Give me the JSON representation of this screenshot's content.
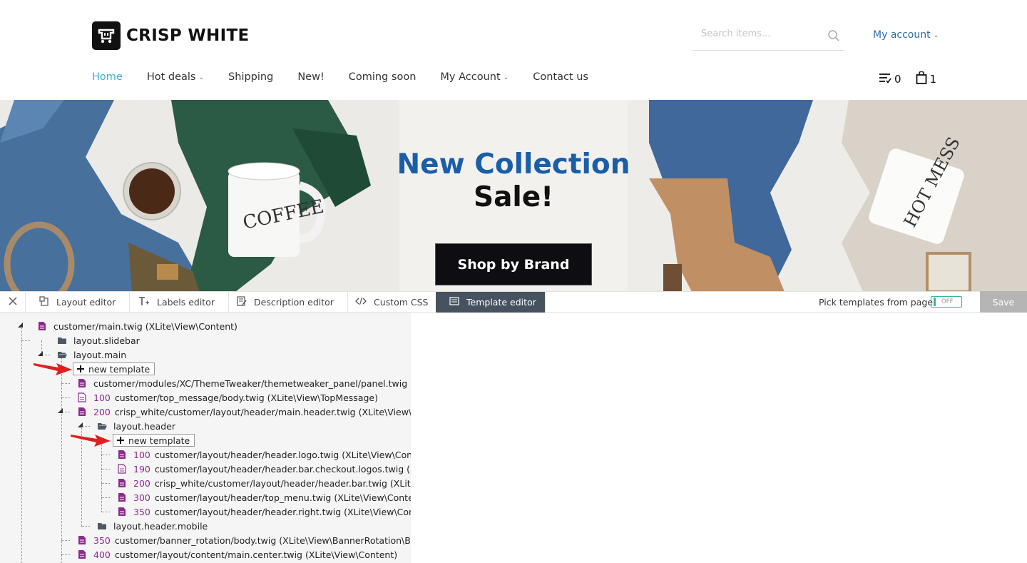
{
  "header": {
    "logo_text": "CRISP WHITE",
    "search_placeholder": "Search items...",
    "my_account": "My account"
  },
  "nav": [
    {
      "label": "Home",
      "active": true,
      "caret": false
    },
    {
      "label": "Hot deals",
      "caret": true
    },
    {
      "label": "Shipping",
      "caret": false
    },
    {
      "label": "New!",
      "caret": false
    },
    {
      "label": "Coming soon",
      "caret": false
    },
    {
      "label": "My Account",
      "caret": true
    },
    {
      "label": "Contact us",
      "caret": false
    }
  ],
  "header_icons": {
    "compare_count": "0",
    "cart_count": "1"
  },
  "banner": {
    "title": "New Collection",
    "subtitle": "Sale!",
    "button": "Shop by Brand",
    "mug_left_text": "COFFEE",
    "mug_right_text": "HOT MESS"
  },
  "tweaker": {
    "tabs": [
      {
        "label": "Layout editor",
        "icon": "layout-icon"
      },
      {
        "label": "Labels editor",
        "icon": "text-icon"
      },
      {
        "label": "Description editor",
        "icon": "description-icon"
      },
      {
        "label": "Custom CSS",
        "icon": "code-icon"
      },
      {
        "label": "Template editor",
        "icon": "template-icon",
        "active": true
      }
    ],
    "pick_label": "Pick templates from page",
    "toggle_state": "OFF",
    "save": "Save"
  },
  "tree": {
    "root": "customer/main.twig (XLite\\View\\Content)",
    "slidebar": "layout.slidebar",
    "main": "layout.main",
    "new_template": "new template",
    "panel": "customer/modules/XC/ThemeTweaker/themetweaker_panel/panel.twig (XLite\\View\\",
    "top_message": {
      "weight": "100",
      "path": "customer/top_message/body.twig (XLite\\View\\TopMessage)"
    },
    "header_main": {
      "weight": "200",
      "path": "crisp_white/customer/layout/header/main.header.twig (XLite\\View\\Content)"
    },
    "layout_header": "layout.header",
    "header_children": [
      {
        "weight": "100",
        "path": "customer/layout/header/header.logo.twig (XLite\\View\\Content)"
      },
      {
        "weight": "190",
        "path": "customer/layout/header/header.bar.checkout.logos.twig (XLite\\View\\"
      },
      {
        "weight": "200",
        "path": "crisp_white/customer/layout/header/header.bar.twig (XLite\\View\\"
      },
      {
        "weight": "300",
        "path": "customer/layout/header/top_menu.twig (XLite\\View\\Content)"
      },
      {
        "weight": "350",
        "path": "customer/layout/header/header.right.twig (XLite\\View\\Content)"
      }
    ],
    "layout_header_mobile": "layout.header.mobile",
    "banner_rotation": {
      "weight": "350",
      "path": "customer/banner_rotation/body.twig (XLite\\View\\BannerRotation\\BannerRotation)"
    },
    "main_center": {
      "weight": "400",
      "path": "customer/layout/content/main.center.twig (XLite\\View\\Content)"
    }
  },
  "colors": {
    "nav_active": "#3aaed8",
    "account_link": "#2f6ea5",
    "banner_title": "#1a5ea8",
    "tab_active_bg": "#475260",
    "weight_purple": "#8c2b8c",
    "annotation_arrow": "#e02020"
  }
}
